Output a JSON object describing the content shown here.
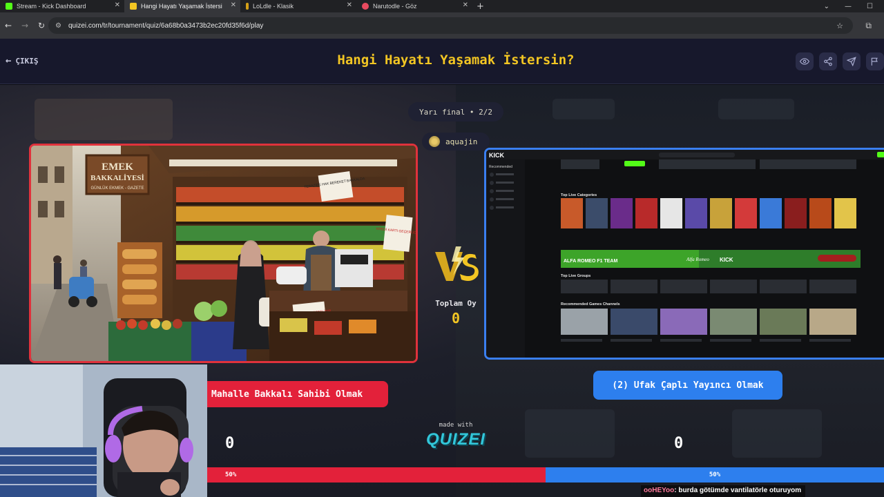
{
  "browser": {
    "tabs": [
      {
        "label": "Stream - Kick Dashboard",
        "favicon_color": "#53fc18",
        "active": false
      },
      {
        "label": "Hangi Hayatı Yaşamak İstersin?",
        "favicon_color": "#f3c623",
        "active": true
      },
      {
        "label": "LoLdle - Klasik",
        "favicon_color": "#d4a017",
        "active": false
      },
      {
        "label": "Narutodle - Göz",
        "favicon_color": "#e84a5f",
        "active": false
      }
    ],
    "url": "quizei.com/tr/tournament/quiz/6a68b0a3473b2ec20fd35f6d/play"
  },
  "header": {
    "exit_label": "ÇIKIŞ",
    "title": "Hangi Hayatı Yaşamak İstersin?"
  },
  "round": "Yarı final • 2/2",
  "creator": "aquajin",
  "left_image": {
    "sign_1": "EMEK",
    "sign_2": "BAKKALİYESİ",
    "sign_3": "GÜNLÜK EKMEK - GAZETE",
    "sign_4": "TERAZİDE HAK BEREKET BAKKALDA",
    "sign_5": "KREDİ KARTI GEÇERLİDİR",
    "sign_6": "KREDİ KARTI GEÇERLİDİR"
  },
  "right_image": {
    "brand": "KICK",
    "sections": [
      "Top Live Categories",
      "Top Live Groups",
      "Recommended Games Channels"
    ],
    "banner": "ALFA ROMEO F1 TEAM",
    "banner_tag": "Alfa Romeo",
    "banner_brand": "KICK",
    "sidebar_label": "Recommended"
  },
  "vote": {
    "label": "Toplam Oy",
    "count": "0"
  },
  "options": {
    "left": "Mahalle Bakkalı Sahibi Olmak",
    "right": "(2) Ufak Çaplı Yayıncı Olmak"
  },
  "made_with": "made with",
  "brand": "QUIZEI",
  "scores": {
    "left": "0",
    "right": "0"
  },
  "percent": {
    "left_value": 50,
    "right_value": 50,
    "left_label": "50%",
    "right_label": "50%"
  },
  "chat": {
    "user": "ooHEYoo",
    "message": ": burda götümde vantilatörle oturuyom"
  },
  "colors": {
    "accent_yellow": "#f3c623",
    "red": "#e3213a",
    "blue": "#2d7fee",
    "brand_cyan": "#32c6d9"
  }
}
